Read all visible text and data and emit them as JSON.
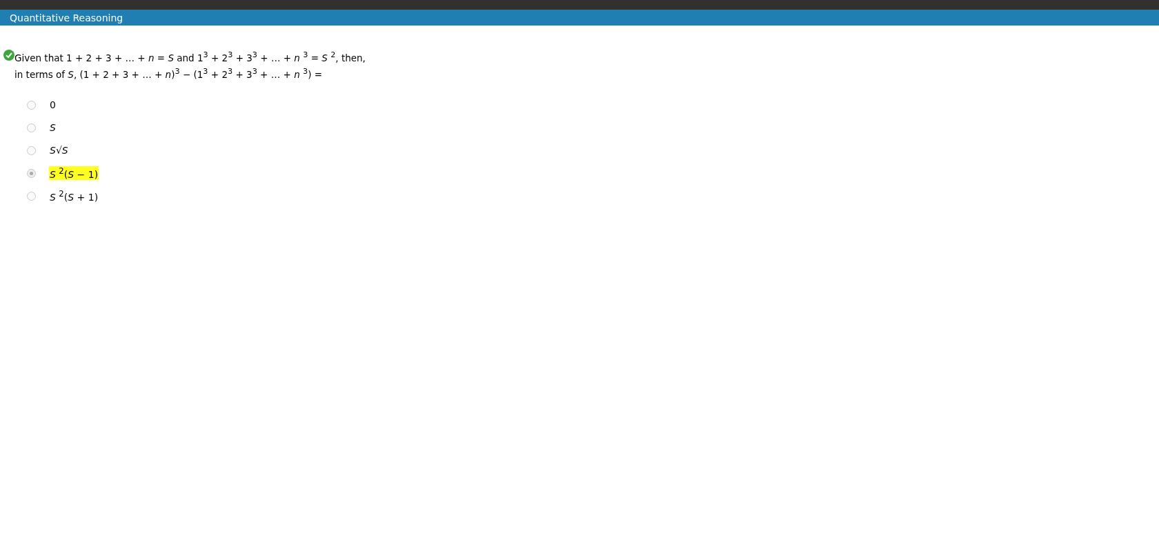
{
  "header": {
    "title": "Quantitative Reasoning"
  },
  "question": {
    "correct": true,
    "text": "Given that 1 + 2 + 3 + … + *n* = *S* and 1$^{3}$ + 2$^{3}$ + 3$^{3}$ + … + *n* $^{3}$ = *S* $^{2}$, then,",
    "text_2": "in terms of *S*, (1 + 2 + 3 + … + *n*)$^{3}$ − (1$^{3}$ + 2$^{3}$ + 3$^{3}$ + … + *n* $^{3}$) ="
  },
  "options": [
    {
      "label": "0",
      "selected": false
    },
    {
      "label": "*S*",
      "selected": false
    },
    {
      "label": "*S*√*S*",
      "selected": false
    },
    {
      "label": "*S* $^{2}$(*S* − 1)",
      "selected": true
    },
    {
      "label": "*S* $^{2}$(*S* + 1)",
      "selected": false
    }
  ]
}
